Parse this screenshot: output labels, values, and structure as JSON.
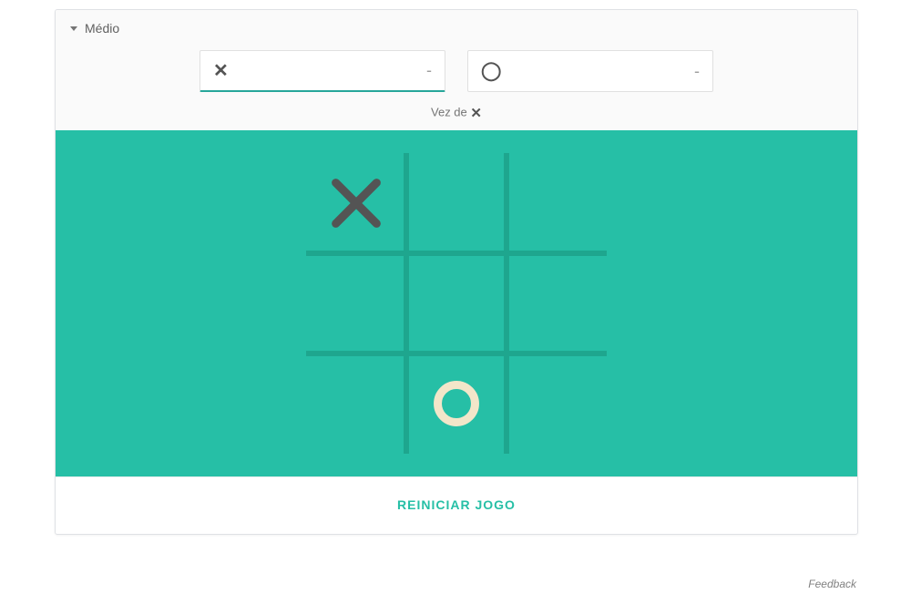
{
  "difficulty": {
    "selected_label": "Médio"
  },
  "scores": {
    "x_mark": "✕",
    "o_mark": "◯",
    "x_value": "-",
    "o_value": "-",
    "active_player": "x"
  },
  "turn": {
    "prefix": "Vez de ",
    "player_mark": "✕"
  },
  "board": {
    "grid_size": 3,
    "cells": [
      [
        "X",
        "",
        ""
      ],
      [
        "",
        "",
        ""
      ],
      [
        "",
        "O",
        ""
      ]
    ],
    "colors": {
      "background": "#26BFA6",
      "grid_line": "#1EA68E",
      "x_color": "#545454",
      "o_color": "#F2E6C9"
    }
  },
  "restart_label": "REINICIAR JOGO",
  "feedback_label": "Feedback"
}
